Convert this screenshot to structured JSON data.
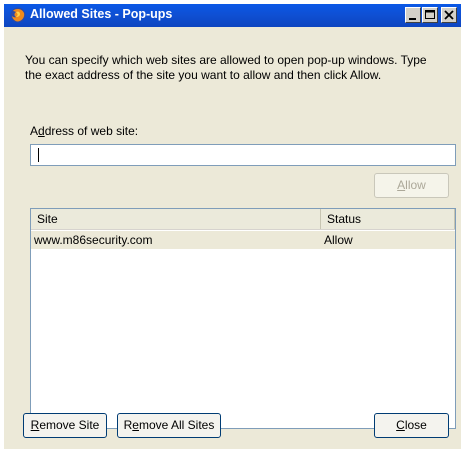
{
  "window": {
    "title": "Allowed Sites - Pop-ups",
    "icon": "firefox-icon",
    "controls": [
      "minimize-icon",
      "maximize-icon",
      "close-icon"
    ]
  },
  "dialog": {
    "intro_text": "You can specify which web sites are allowed to open pop-up windows. Type the exact address of the site you want to allow and then click Allow.",
    "address_label_accesskey": "d",
    "address_label_pre": "A",
    "address_label_post": "dress of web site:",
    "address_value": "",
    "allow_button": {
      "accesskey": "A",
      "rest": "llow",
      "disabled": true
    },
    "table": {
      "columns": [
        "Site",
        "Status"
      ],
      "rows": [
        {
          "site": "www.m86security.com",
          "status": "Allow"
        }
      ]
    },
    "buttons": {
      "remove_site": {
        "accesskey": "R",
        "rest": "emove Site"
      },
      "remove_all": {
        "pre": "R",
        "accesskey": "e",
        "rest": "move All Sites"
      },
      "close": {
        "accesskey": "C",
        "rest": "lose"
      }
    }
  },
  "colors": {
    "titlebar": "#0a58e6",
    "dialog_bg": "#ece9d8",
    "input_border": "#7f9db9",
    "button_border": "#003c74"
  }
}
